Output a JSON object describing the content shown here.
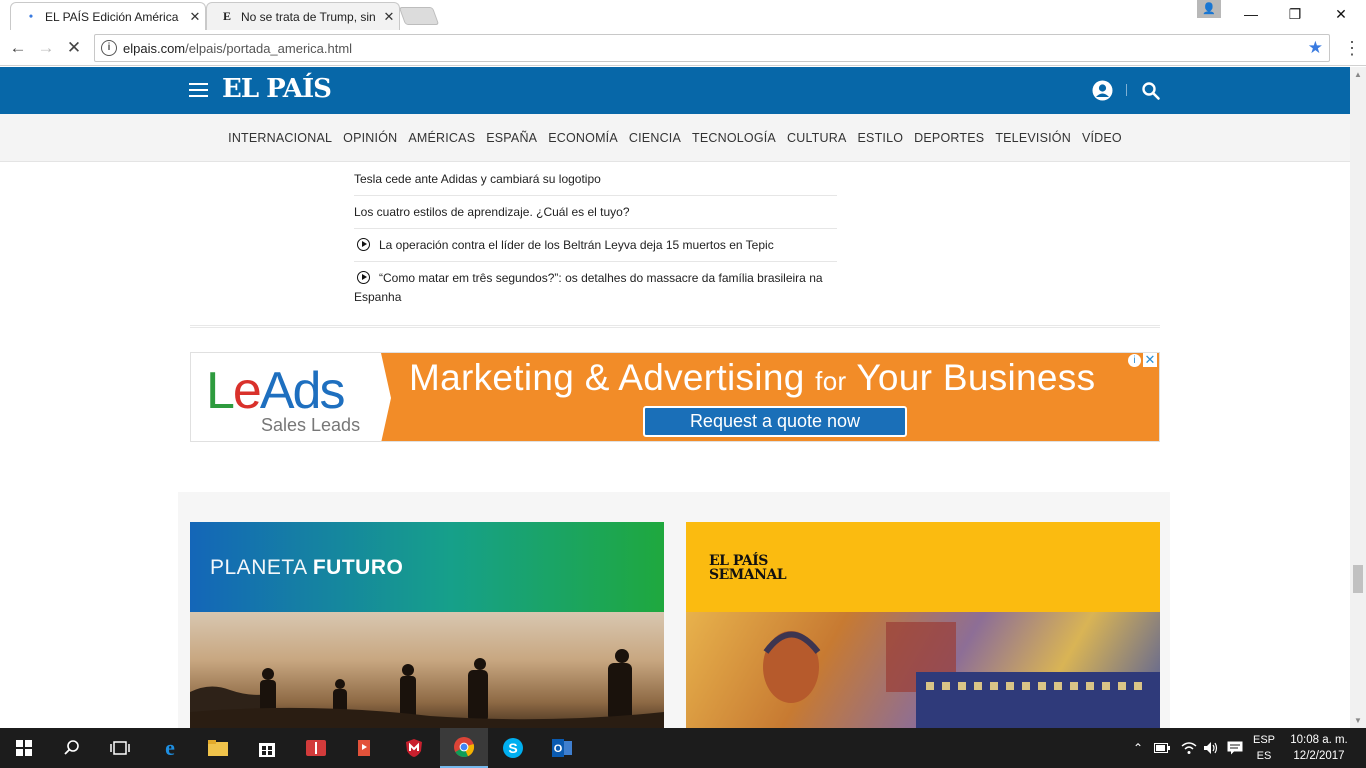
{
  "browser": {
    "tabs": [
      {
        "title": "EL PAÍS Edición América",
        "favicon": "loading-dot",
        "active": true
      },
      {
        "title": "No se trata de Trump, sin",
        "favicon": "E",
        "active": false
      }
    ],
    "url_domain": "elpais.com",
    "url_path": "/elpais/portada_america.html",
    "window_controls": {
      "minimize": "—",
      "restore": "❐",
      "close": "✕"
    }
  },
  "site": {
    "logo": "EL PAÍS",
    "sections": [
      "INTERNACIONAL",
      "OPINIÓN",
      "AMÉRICAS",
      "ESPAÑA",
      "ECONOMÍA",
      "CIENCIA",
      "TECNOLOGÍA",
      "CULTURA",
      "ESTILO",
      "DEPORTES",
      "TELEVISIÓN",
      "VÍDEO"
    ],
    "brand_color": "#0767a8"
  },
  "news": [
    {
      "text": "Tesla cede ante Adidas y cambiará su logotipo",
      "video": false
    },
    {
      "text": "Los cuatro estilos de aprendizaje. ¿Cuál es el tuyo?",
      "video": false
    },
    {
      "text": "La operación contra el líder de los Beltrán Leyva deja 15 muertos en Tepic",
      "video": true
    },
    {
      "text": "“Como matar em três segundos?”: os detalhes do massacre da família brasileira na Espanha",
      "video": true
    }
  ],
  "ad": {
    "logo_parts": [
      "L",
      "e",
      "Ads"
    ],
    "subtitle": "Sales Leads",
    "headline_a": "Marketing & Advertising ",
    "headline_b": "for",
    "headline_c": " Your Business",
    "cta": "Request a quote now",
    "bg_color": "#f28c28"
  },
  "promos": {
    "planeta_light": "PLANETA ",
    "planeta_bold": "FUTURO",
    "semanal_line1": "EL PAÍS",
    "semanal_line2": "SEMANAL"
  },
  "taskbar": {
    "lang_top": "ESP",
    "lang_bottom": "ES",
    "time": "10:08 a. m.",
    "date": "12/2/2017"
  }
}
